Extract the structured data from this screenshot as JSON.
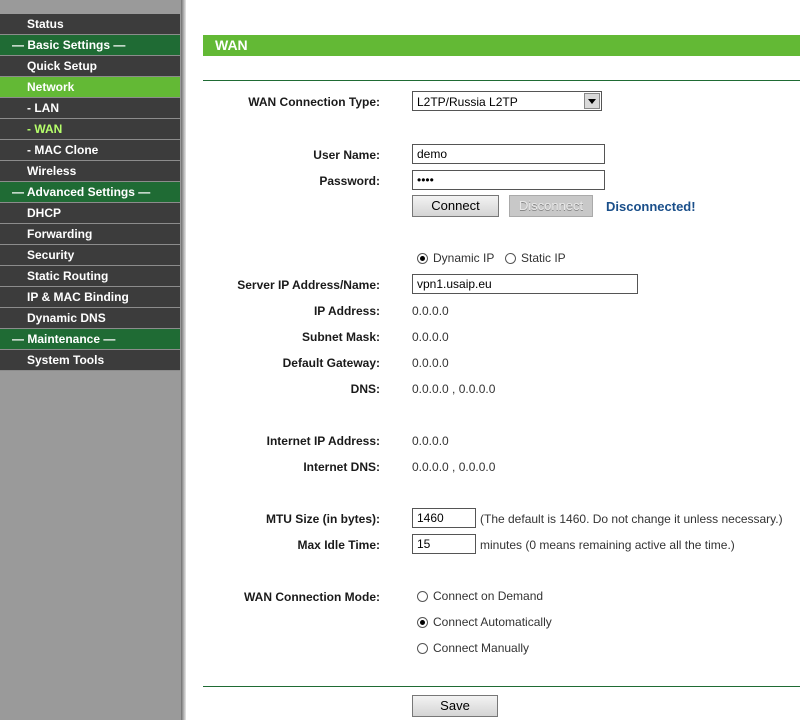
{
  "sidebar": {
    "items": [
      {
        "label": "Status",
        "type": "item"
      },
      {
        "label": "— Basic Settings —",
        "type": "section"
      },
      {
        "label": "Quick Setup",
        "type": "item"
      },
      {
        "label": "Network",
        "type": "active"
      },
      {
        "label": "- LAN",
        "type": "item"
      },
      {
        "label": "- WAN",
        "type": "sub-active"
      },
      {
        "label": "- MAC Clone",
        "type": "item"
      },
      {
        "label": "Wireless",
        "type": "item"
      },
      {
        "label": "— Advanced Settings —",
        "type": "section"
      },
      {
        "label": "DHCP",
        "type": "item"
      },
      {
        "label": "Forwarding",
        "type": "item"
      },
      {
        "label": "Security",
        "type": "item"
      },
      {
        "label": "Static Routing",
        "type": "item"
      },
      {
        "label": "IP & MAC Binding",
        "type": "item"
      },
      {
        "label": "Dynamic DNS",
        "type": "item"
      },
      {
        "label": "— Maintenance —",
        "type": "section"
      },
      {
        "label": "System Tools",
        "type": "item"
      }
    ]
  },
  "main": {
    "title": "WAN",
    "connection_type": {
      "label": "WAN Connection Type:",
      "value": "L2TP/Russia L2TP"
    },
    "username": {
      "label": "User Name:",
      "value": "demo"
    },
    "password": {
      "label": "Password:",
      "value": "••••"
    },
    "connect_button": "Connect",
    "disconnect_button": "Disconnect",
    "status": "Disconnected!",
    "ip_mode": {
      "dynamic": "Dynamic IP",
      "static": "Static IP",
      "selected": "dynamic"
    },
    "server": {
      "label": "Server IP Address/Name:",
      "value": "vpn1.usaip.eu"
    },
    "ip_address": {
      "label": "IP Address:",
      "value": "0.0.0.0"
    },
    "subnet_mask": {
      "label": "Subnet Mask:",
      "value": "0.0.0.0"
    },
    "default_gateway": {
      "label": "Default Gateway:",
      "value": "0.0.0.0"
    },
    "dns": {
      "label": "DNS:",
      "value": "0.0.0.0 , 0.0.0.0"
    },
    "internet_ip": {
      "label": "Internet IP Address:",
      "value": "0.0.0.0"
    },
    "internet_dns": {
      "label": "Internet DNS:",
      "value": "0.0.0.0 , 0.0.0.0"
    },
    "mtu": {
      "label": "MTU Size (in bytes):",
      "value": "1460",
      "note": "(The default is 1460. Do not change it unless necessary.)"
    },
    "idle": {
      "label": "Max Idle Time:",
      "value": "15",
      "note": "minutes (0 means remaining active all the time.)"
    },
    "mode": {
      "label": "WAN Connection Mode:",
      "options": [
        "Connect on Demand",
        "Connect Automatically",
        "Connect Manually"
      ],
      "selected": "Connect Automatically"
    },
    "save_button": "Save"
  },
  "colors": {
    "accent_green": "#63b935",
    "section_green": "#1f6b34",
    "menu_dark": "#3c3c3c",
    "status_blue": "#1a4f8a"
  }
}
